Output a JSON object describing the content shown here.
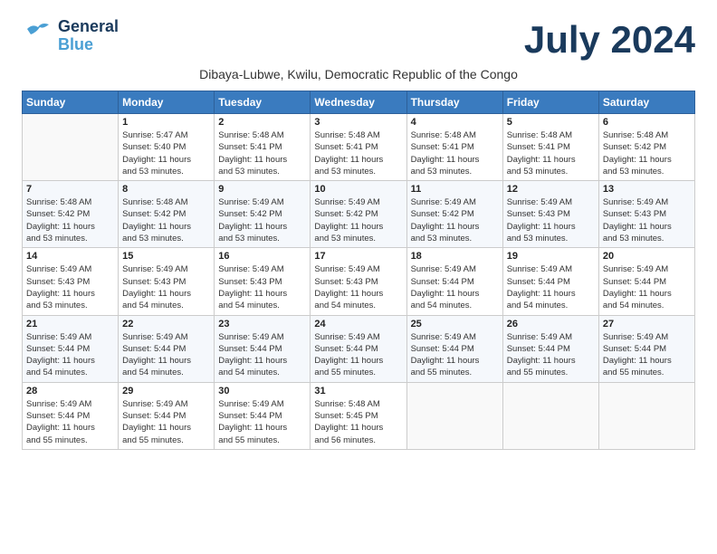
{
  "header": {
    "logo_line1": "General",
    "logo_line2": "Blue",
    "month_title": "July 2024",
    "subtitle": "Dibaya-Lubwe, Kwilu, Democratic Republic of the Congo"
  },
  "days_of_week": [
    "Sunday",
    "Monday",
    "Tuesday",
    "Wednesday",
    "Thursday",
    "Friday",
    "Saturday"
  ],
  "weeks": [
    [
      {
        "day": "",
        "info": ""
      },
      {
        "day": "1",
        "info": "Sunrise: 5:47 AM\nSunset: 5:40 PM\nDaylight: 11 hours\nand 53 minutes."
      },
      {
        "day": "2",
        "info": "Sunrise: 5:48 AM\nSunset: 5:41 PM\nDaylight: 11 hours\nand 53 minutes."
      },
      {
        "day": "3",
        "info": "Sunrise: 5:48 AM\nSunset: 5:41 PM\nDaylight: 11 hours\nand 53 minutes."
      },
      {
        "day": "4",
        "info": "Sunrise: 5:48 AM\nSunset: 5:41 PM\nDaylight: 11 hours\nand 53 minutes."
      },
      {
        "day": "5",
        "info": "Sunrise: 5:48 AM\nSunset: 5:41 PM\nDaylight: 11 hours\nand 53 minutes."
      },
      {
        "day": "6",
        "info": "Sunrise: 5:48 AM\nSunset: 5:42 PM\nDaylight: 11 hours\nand 53 minutes."
      }
    ],
    [
      {
        "day": "7",
        "info": "Sunrise: 5:48 AM\nSunset: 5:42 PM\nDaylight: 11 hours\nand 53 minutes."
      },
      {
        "day": "8",
        "info": "Sunrise: 5:48 AM\nSunset: 5:42 PM\nDaylight: 11 hours\nand 53 minutes."
      },
      {
        "day": "9",
        "info": "Sunrise: 5:49 AM\nSunset: 5:42 PM\nDaylight: 11 hours\nand 53 minutes."
      },
      {
        "day": "10",
        "info": "Sunrise: 5:49 AM\nSunset: 5:42 PM\nDaylight: 11 hours\nand 53 minutes."
      },
      {
        "day": "11",
        "info": "Sunrise: 5:49 AM\nSunset: 5:42 PM\nDaylight: 11 hours\nand 53 minutes."
      },
      {
        "day": "12",
        "info": "Sunrise: 5:49 AM\nSunset: 5:43 PM\nDaylight: 11 hours\nand 53 minutes."
      },
      {
        "day": "13",
        "info": "Sunrise: 5:49 AM\nSunset: 5:43 PM\nDaylight: 11 hours\nand 53 minutes."
      }
    ],
    [
      {
        "day": "14",
        "info": "Sunrise: 5:49 AM\nSunset: 5:43 PM\nDaylight: 11 hours\nand 53 minutes."
      },
      {
        "day": "15",
        "info": "Sunrise: 5:49 AM\nSunset: 5:43 PM\nDaylight: 11 hours\nand 54 minutes."
      },
      {
        "day": "16",
        "info": "Sunrise: 5:49 AM\nSunset: 5:43 PM\nDaylight: 11 hours\nand 54 minutes."
      },
      {
        "day": "17",
        "info": "Sunrise: 5:49 AM\nSunset: 5:43 PM\nDaylight: 11 hours\nand 54 minutes."
      },
      {
        "day": "18",
        "info": "Sunrise: 5:49 AM\nSunset: 5:44 PM\nDaylight: 11 hours\nand 54 minutes."
      },
      {
        "day": "19",
        "info": "Sunrise: 5:49 AM\nSunset: 5:44 PM\nDaylight: 11 hours\nand 54 minutes."
      },
      {
        "day": "20",
        "info": "Sunrise: 5:49 AM\nSunset: 5:44 PM\nDaylight: 11 hours\nand 54 minutes."
      }
    ],
    [
      {
        "day": "21",
        "info": "Sunrise: 5:49 AM\nSunset: 5:44 PM\nDaylight: 11 hours\nand 54 minutes."
      },
      {
        "day": "22",
        "info": "Sunrise: 5:49 AM\nSunset: 5:44 PM\nDaylight: 11 hours\nand 54 minutes."
      },
      {
        "day": "23",
        "info": "Sunrise: 5:49 AM\nSunset: 5:44 PM\nDaylight: 11 hours\nand 54 minutes."
      },
      {
        "day": "24",
        "info": "Sunrise: 5:49 AM\nSunset: 5:44 PM\nDaylight: 11 hours\nand 55 minutes."
      },
      {
        "day": "25",
        "info": "Sunrise: 5:49 AM\nSunset: 5:44 PM\nDaylight: 11 hours\nand 55 minutes."
      },
      {
        "day": "26",
        "info": "Sunrise: 5:49 AM\nSunset: 5:44 PM\nDaylight: 11 hours\nand 55 minutes."
      },
      {
        "day": "27",
        "info": "Sunrise: 5:49 AM\nSunset: 5:44 PM\nDaylight: 11 hours\nand 55 minutes."
      }
    ],
    [
      {
        "day": "28",
        "info": "Sunrise: 5:49 AM\nSunset: 5:44 PM\nDaylight: 11 hours\nand 55 minutes."
      },
      {
        "day": "29",
        "info": "Sunrise: 5:49 AM\nSunset: 5:44 PM\nDaylight: 11 hours\nand 55 minutes."
      },
      {
        "day": "30",
        "info": "Sunrise: 5:49 AM\nSunset: 5:44 PM\nDaylight: 11 hours\nand 55 minutes."
      },
      {
        "day": "31",
        "info": "Sunrise: 5:48 AM\nSunset: 5:45 PM\nDaylight: 11 hours\nand 56 minutes."
      },
      {
        "day": "",
        "info": ""
      },
      {
        "day": "",
        "info": ""
      },
      {
        "day": "",
        "info": ""
      }
    ]
  ]
}
